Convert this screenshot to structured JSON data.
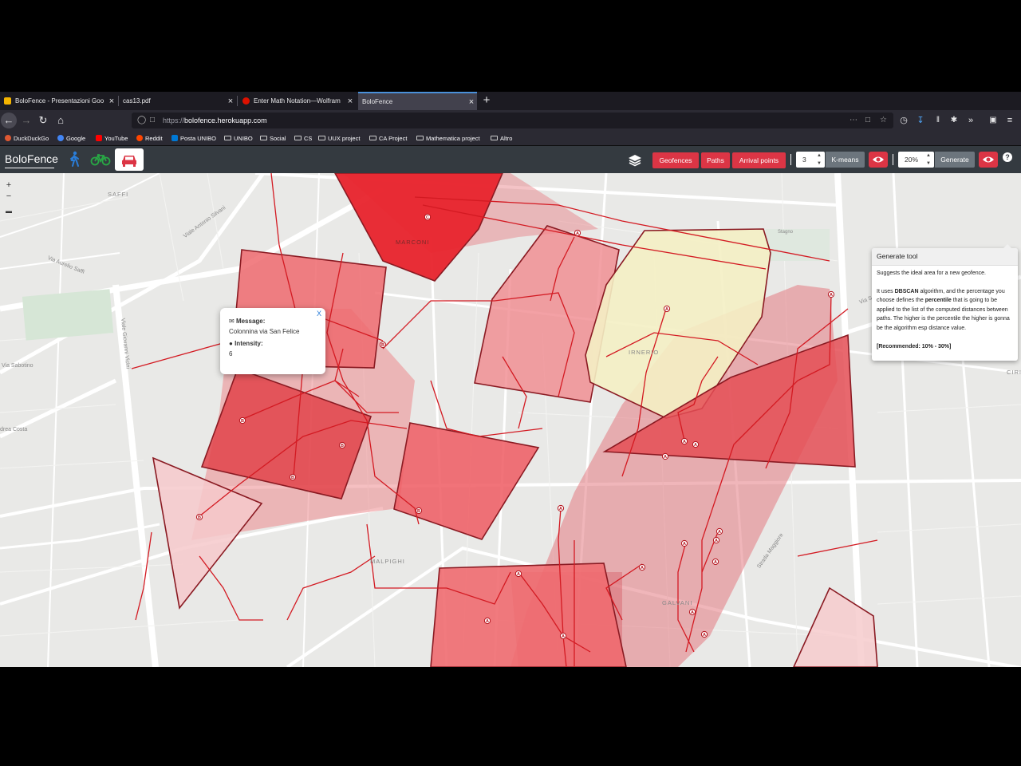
{
  "browser": {
    "tabs": [
      {
        "title": "BoloFence - Presentazioni Goo",
        "icon": "google-slides-icon",
        "color": "#f4b400"
      },
      {
        "title": "cas13.pdf",
        "icon": "pdf-icon",
        "color": ""
      },
      {
        "title": "Enter Math Notation—Wolfram",
        "icon": "wolfram-icon",
        "color": "#dd1100"
      },
      {
        "title": "BoloFence",
        "icon": "",
        "color": "",
        "active": true
      }
    ],
    "close_glyph": "×",
    "new_tab_glyph": "+",
    "url_prefix": "https://",
    "url_host": "bolofence.herokuapp.com",
    "bookmarks": [
      {
        "label": "DuckDuckGo",
        "icon": "duckduckgo-icon",
        "color": "#de5833"
      },
      {
        "label": "Google",
        "icon": "google-icon",
        "color": "#4285f4"
      },
      {
        "label": "YouTube",
        "icon": "youtube-icon",
        "color": "#ff0000"
      },
      {
        "label": "Reddit",
        "icon": "reddit-icon",
        "color": "#ff4500"
      },
      {
        "label": "Posta UNIBO",
        "icon": "outlook-icon",
        "color": "#0078d4"
      },
      {
        "label": "UNIBO",
        "icon": "folder-icon"
      },
      {
        "label": "Social",
        "icon": "folder-icon"
      },
      {
        "label": "CS",
        "icon": "folder-icon"
      },
      {
        "label": "UUX project",
        "icon": "folder-icon"
      },
      {
        "label": "CA Project",
        "icon": "folder-icon"
      },
      {
        "label": "Mathematica project",
        "icon": "folder-icon"
      },
      {
        "label": "Altro",
        "icon": "folder-icon"
      }
    ]
  },
  "app": {
    "brand": "BoloFence",
    "modes": [
      "walk-icon",
      "bike-icon",
      "car-icon"
    ],
    "active_mode": "car",
    "buttons": {
      "geofences": "Geofences",
      "paths": "Paths",
      "arrival_points": "Arrival points",
      "kmeans_value": "3",
      "kmeans": "K-means",
      "percent_value": "20%",
      "generate": "Generate"
    },
    "help_glyph": "?",
    "accent": "#dc3545"
  },
  "map": {
    "zoom_in": "+",
    "zoom_out": "−",
    "labels": [
      "SAFFI",
      "MARCONI",
      "IRNERIO",
      "MALPIGHI",
      "GALVANI",
      "CIRI"
    ],
    "street_labels": [
      "Viale Antonio Silvani",
      "Via Aurelio Saffi",
      "Via Sabotino",
      "Via San Donato",
      "Viale Giovanni Vicini",
      "Stagno",
      "drea Costa",
      "Strada Maggiore"
    ],
    "markers": [
      "A",
      "B",
      "C"
    ],
    "popup": {
      "close": "X",
      "message_label": "Message:",
      "message": "Colonnina via San Felice",
      "intensity_label": "Intensity:",
      "intensity": "6"
    }
  },
  "tooltip": {
    "title": "Generate tool",
    "p1": "Suggests the ideal area for a new geofence.",
    "p2_a": "It uses ",
    "p2_b": "DBSCAN",
    "p2_c": " algorithm, and the percentage you choose defines the ",
    "p2_d": "percentile",
    "p2_e": " that is going to be applied to the list of the computed distances between paths. The higher is the percentile the higher is gonna be the algorithm esp distance value.",
    "recommended": "[Recommended: 10% - 30%]"
  }
}
